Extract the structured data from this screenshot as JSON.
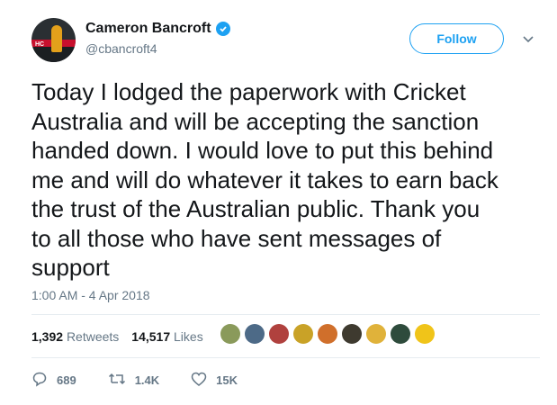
{
  "author": {
    "name": "Cameron Bancroft",
    "handle": "@cbancroft4",
    "avatar_text": "HC",
    "verified_icon": "verified-badge-icon"
  },
  "follow_label": "Follow",
  "tweet_lines": [
    "Today I lodged the paperwork with Cricket",
    "Australia and will be accepting the sanction",
    "handed down. I would love to put this behind",
    "me and will do whatever it takes to earn back",
    "the trust of the Australian public. Thank you",
    "to all those who have sent messages of",
    "support"
  ],
  "timestamp": "1:00 AM - 4 Apr 2018",
  "stats": {
    "retweets_count": "1,392",
    "retweets_label": "Retweets",
    "likes_count": "14,517",
    "likes_label": "Likes"
  },
  "liker_faces": [
    {
      "color": "#8a9a5b"
    },
    {
      "color": "#4d6a87"
    },
    {
      "color": "#b0413e"
    },
    {
      "color": "#c9a227"
    },
    {
      "color": "#d06f2b"
    },
    {
      "color": "#3e3a2f"
    },
    {
      "color": "#e0b23a"
    },
    {
      "color": "#2e4b3c"
    },
    {
      "color": "#f0c419"
    }
  ],
  "actions": {
    "replies": "689",
    "retweets": "1.4K",
    "likes": "15K"
  },
  "colors": {
    "accent": "#1da1f2",
    "text": "#14171a",
    "muted": "#657786"
  }
}
